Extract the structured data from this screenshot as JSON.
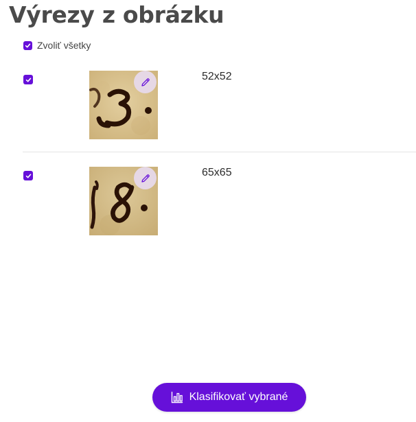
{
  "page": {
    "title": "Výrezy z obrázku"
  },
  "select_all": {
    "label": "Zvoliť všetky",
    "checked": true
  },
  "crops": [
    {
      "size": "52x52",
      "checked": true,
      "digit": "3",
      "edit_icon": "pencil-icon"
    },
    {
      "size": "65x65",
      "checked": true,
      "digit": "8",
      "edit_icon": "pencil-icon"
    }
  ],
  "actions": {
    "classify_label": "Klasifikovať vybrané",
    "classify_icon": "bar-chart-icon"
  },
  "colors": {
    "accent": "#6610d9",
    "title": "#4a4a4a",
    "parchment": "#d9c28f",
    "ink": "#2a1206"
  }
}
